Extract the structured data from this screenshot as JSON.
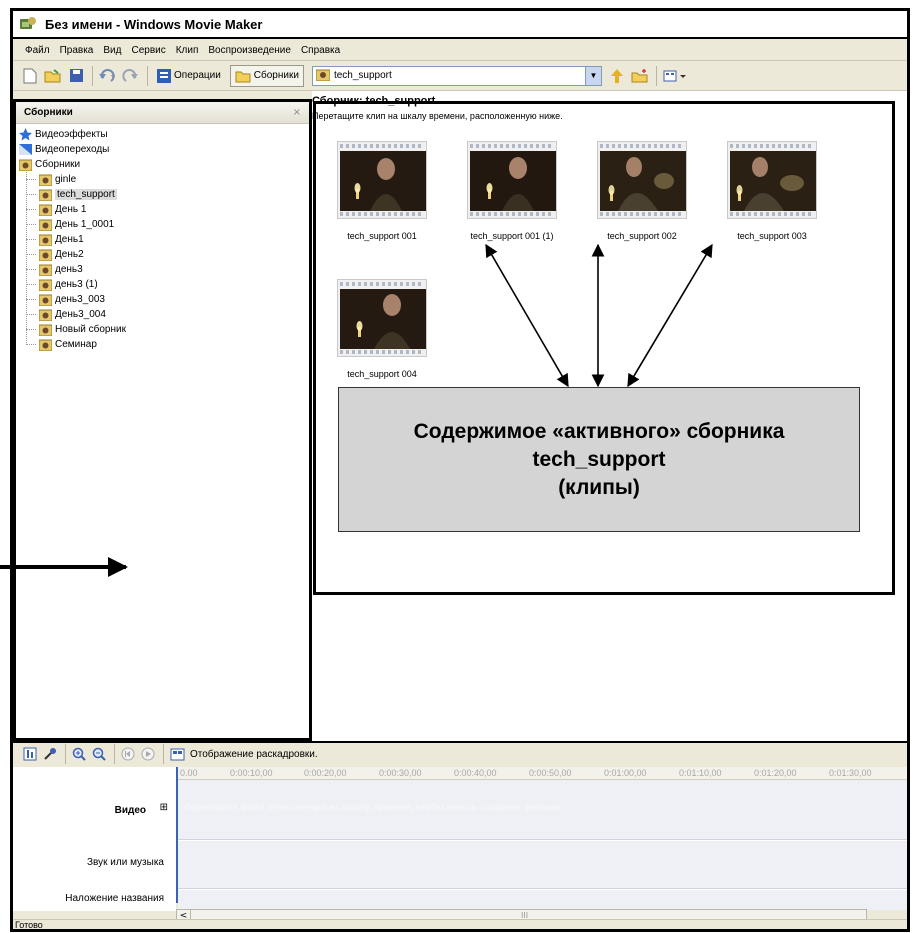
{
  "window": {
    "title": "Без имени - Windows Movie Maker"
  },
  "menu": [
    "Файл",
    "Правка",
    "Вид",
    "Сервис",
    "Клип",
    "Воспроизведение",
    "Справка"
  ],
  "toolbar": {
    "tasks_label": "Операции",
    "collections_label": "Сборники",
    "collection_select_value": "tech_support"
  },
  "collections_pane": {
    "title": "Сборники",
    "close": "×",
    "tree": {
      "video_effects": "Видеоэффекты",
      "video_transitions": "Видеопереходы",
      "collections_root": "Сборники",
      "children": [
        "ginle",
        "tech_support",
        "День 1",
        "День 1_0001",
        "День1",
        "День2",
        "день3",
        "день3 (1)",
        "день3_003",
        "День3_004",
        "Новый сборник",
        "Семинар"
      ]
    }
  },
  "collection_view": {
    "title": "Сборник: tech_support",
    "hint": "Перетащите клип на шкалу времени, расположенную ниже.",
    "clips": [
      "tech_support 001",
      "tech_support 001 (1)",
      "tech_support 002",
      "tech_support 003",
      "tech_support 004"
    ]
  },
  "annotation": {
    "line1": "Содержимое «активного» сборника",
    "line2": "tech_support",
    "line3": "(клипы)"
  },
  "timeline": {
    "storyboard_label": "Отображение раскадровки.",
    "ticks": [
      "0.00",
      "0:00:10,00",
      "0:00:20,00",
      "0:00:30,00",
      "0:00:40,00",
      "0:00:50,00",
      "0:01:00,00",
      "0:01:10,00",
      "0:01:20,00",
      "0:01:30,00"
    ],
    "tracks": {
      "video": "Видео",
      "video_expand": "⊞",
      "audio": "Звук или музыка",
      "title_overlay": "Наложение названия"
    },
    "video_placeholder": "Перетащите файл мультимедиа на шкалу времени, чтобы начать создание фильма.",
    "scroll_thumb": "III",
    "scroll_left": "<"
  },
  "status": "Готово",
  "colors": {
    "window_bg": "#ece9d8",
    "selection": "#dcdcdc",
    "timeline_accent": "#3a62b5",
    "callout_bg": "#d4d4d4"
  }
}
